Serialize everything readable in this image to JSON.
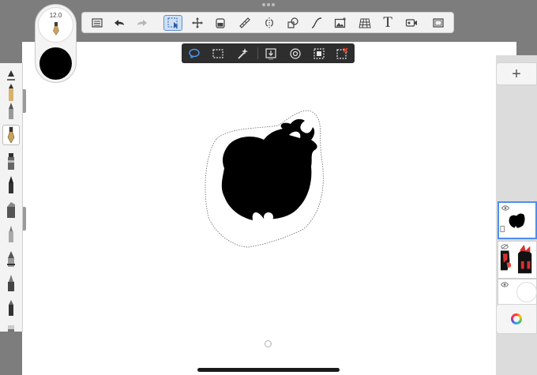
{
  "app": {
    "brush_size": "12.0",
    "current_color": "#000000",
    "accent": "#4c8ff0"
  },
  "toolbar": {
    "tools": [
      {
        "name": "lists-icon",
        "active": false
      },
      {
        "name": "undo-icon",
        "active": false
      },
      {
        "name": "redo-icon",
        "active": false
      },
      {
        "name": "selection-icon",
        "active": true
      },
      {
        "name": "transform-icon",
        "active": false
      },
      {
        "name": "fill-icon",
        "active": false
      },
      {
        "name": "ruler-icon",
        "active": false
      },
      {
        "name": "symmetry-icon",
        "active": false
      },
      {
        "name": "shapes-icon",
        "active": false
      },
      {
        "name": "curve-icon",
        "active": false
      },
      {
        "name": "image-icon",
        "active": false
      },
      {
        "name": "perspective-icon",
        "active": false
      },
      {
        "name": "text-icon",
        "label": "T",
        "active": false
      },
      {
        "name": "video-icon",
        "active": false
      },
      {
        "name": "fullscreen-icon",
        "active": false
      }
    ]
  },
  "selection_bar": {
    "tools": [
      "lasso-icon",
      "rectangle-select-icon",
      "magic-wand-icon",
      "paste-into-icon",
      "target-icon",
      "select-all-icon",
      "clear-selection-icon"
    ],
    "active": "lasso-icon"
  },
  "layers": {
    "add_label": "+",
    "items": [
      {
        "name": "layer-silhouette",
        "visible": true,
        "active": true
      },
      {
        "name": "layer-characters",
        "visible": false,
        "active": false
      },
      {
        "name": "layer-background",
        "visible": true,
        "active": false
      }
    ]
  }
}
